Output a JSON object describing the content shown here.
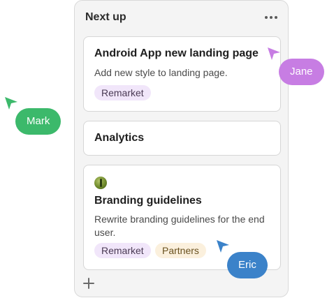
{
  "column": {
    "title": "Next up"
  },
  "cards": [
    {
      "title": "Android App new landing page",
      "description": "Add new style to landing page.",
      "tags": [
        "Remarket"
      ]
    },
    {
      "title": "Analytics"
    },
    {
      "title": "Branding guidelines",
      "description": "Rewrite branding guidelines for the end user.",
      "tags": [
        "Remarket",
        "Partners"
      ]
    }
  ],
  "collaborators": [
    {
      "name": "Mark",
      "color": "#3cb96b"
    },
    {
      "name": "Jane",
      "color": "#c77de3"
    },
    {
      "name": "Eric",
      "color": "#3b82c9"
    }
  ],
  "icons": {
    "more": "more-horizontal-icon",
    "add": "plus-icon",
    "cursor": "pointer-cursor-icon"
  }
}
